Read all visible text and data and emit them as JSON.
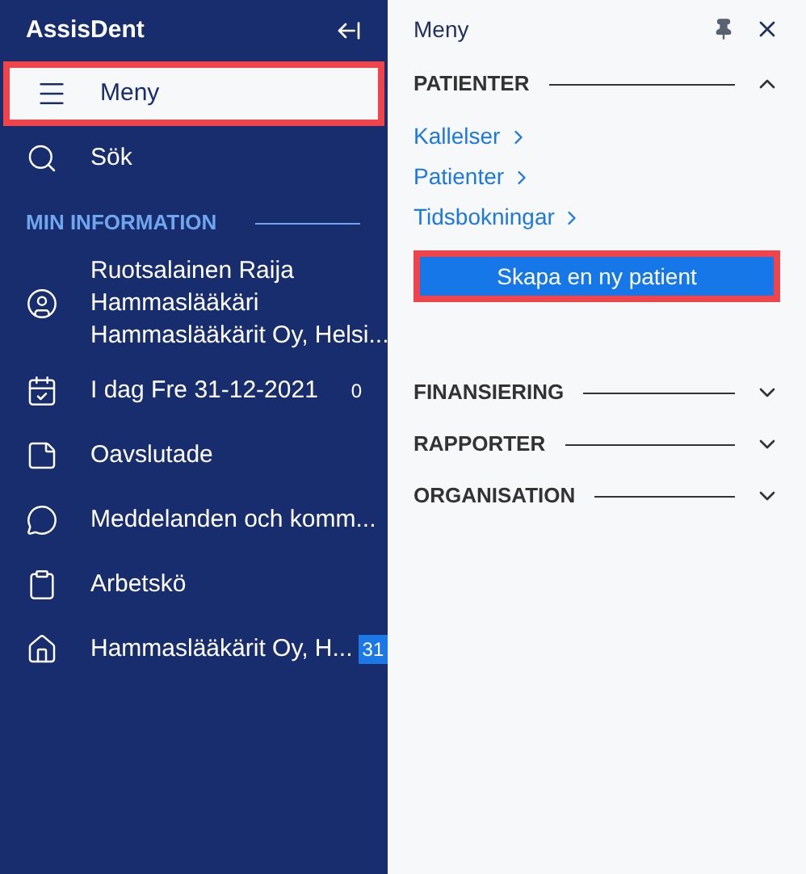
{
  "sidebar": {
    "title": "AssisDent",
    "items": [
      {
        "label": "Meny",
        "selected": true,
        "highlighted": true
      },
      {
        "label": "Sök",
        "selected": false,
        "highlighted": false
      }
    ],
    "section": "MIN INFORMATION",
    "info_items": [
      {
        "kind": "entry",
        "lines": [
          "Ruotsalainen Raija",
          "Hammaslääkäri",
          "Hammaslääkärit Oy, Helsi..."
        ]
      },
      {
        "kind": "counted",
        "lines": [
          "I dag Fre 31-12-2021"
        ],
        "count": "0"
      },
      {
        "kind": "entry",
        "lines": [
          "Oavslutade"
        ]
      },
      {
        "kind": "entry",
        "lines": [
          "Meddelanden och komm..."
        ]
      },
      {
        "kind": "entry",
        "lines": [
          "Arbetskö"
        ]
      },
      {
        "kind": "badged",
        "lines": [
          "Hammaslääkärit Oy, H..."
        ],
        "count": "31"
      }
    ]
  },
  "panel": {
    "title": "Meny",
    "sections": [
      {
        "title": "PATIENTER",
        "expanded": true,
        "links": [
          "Kallelser",
          "Patienter",
          "Tidsbokningar"
        ],
        "button": {
          "label": "Skapa en ny patient",
          "highlighted": true
        }
      },
      {
        "title": "FINANSIERING",
        "expanded": false
      },
      {
        "title": "RAPPORTER",
        "expanded": false
      },
      {
        "title": "ORGANISATION",
        "expanded": false
      }
    ]
  }
}
